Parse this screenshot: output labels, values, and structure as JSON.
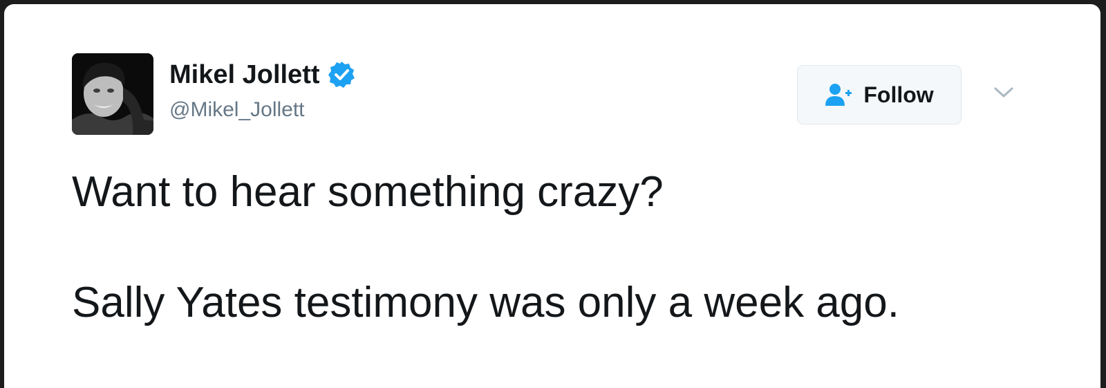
{
  "author": {
    "display_name": "Mikel Jollett",
    "handle": "@Mikel_Jollett",
    "verified": true,
    "avatar_icon": "profile-photo",
    "verified_icon": "verified-badge-icon"
  },
  "actions": {
    "follow_label": "Follow",
    "follow_icon": "add-user-icon",
    "menu_icon": "chevron-down-icon"
  },
  "tweet": {
    "lines": [
      "Want to hear something crazy?",
      "Sally Yates testimony was only a week ago."
    ]
  },
  "colors": {
    "accent": "#1da1f2",
    "text": "#14171a",
    "muted": "#657786",
    "button_bg": "#f5f8fa",
    "button_border": "#e1e8ed"
  }
}
